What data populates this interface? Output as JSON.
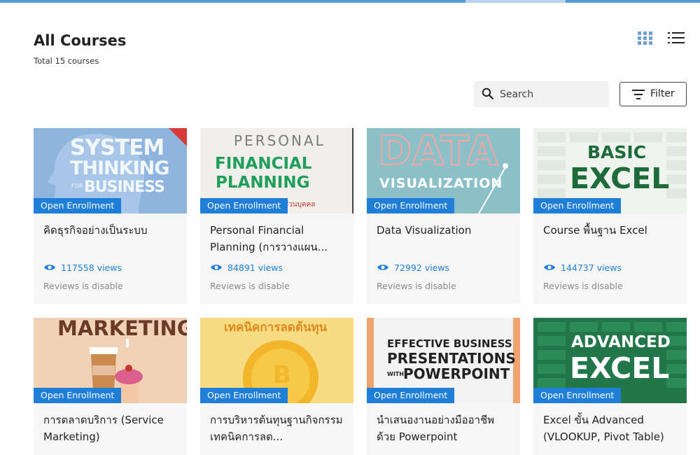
{
  "page": {
    "title": "All Courses",
    "subtitle": "Total 15 courses"
  },
  "search": {
    "placeholder": "Search"
  },
  "filter": {
    "label": "Filter"
  },
  "colors": {
    "accent": "#1f7fd8",
    "topbar": "#5b9bd5",
    "card_bg": "#f6f6f6"
  },
  "courses": [
    {
      "badge": "Open Enrollment",
      "title": "คิดธุรกิจอย่างเป็นระบบ",
      "views": "117558 views",
      "reviews": "Reviews is disable",
      "thumb": {
        "lines": [
          "SYSTEM",
          "THINKING",
          "FOR",
          "BUSINESS"
        ]
      }
    },
    {
      "badge": "Open Enrollment",
      "title": "Personal Financial Planning (การวางแผน...",
      "views": "84891 views",
      "reviews": "Reviews is disable",
      "thumb": {
        "lines": [
          "PERSONAL",
          "FINANCIAL",
          "PLANNING",
          "ส่วนบุคคล"
        ]
      }
    },
    {
      "badge": "Open Enrollment",
      "title": "Data Visualization",
      "views": "72992 views",
      "reviews": "Reviews is disable",
      "thumb": {
        "lines": [
          "DATA",
          "VISUALIZATION"
        ]
      }
    },
    {
      "badge": "Open Enrollment",
      "title": "Course พื้นฐาน Excel",
      "views": "144737 views",
      "reviews": "Reviews is disable",
      "thumb": {
        "lines": [
          "BASIC",
          "EXCEL"
        ]
      }
    },
    {
      "badge": "Open Enrollment",
      "title": "การตลาดบริการ (Service Marketing)",
      "thumb": {
        "lines": [
          "MARKETING"
        ]
      }
    },
    {
      "badge": "Open Enrollment",
      "title": "การบริหารต้นทุนฐานกิจกรรม เทคนิคการลด...",
      "thumb": {
        "lines": [
          "เทคนิคการลดต้นทุน",
          "B"
        ]
      }
    },
    {
      "badge": "Open Enrollment",
      "title": "นำเสนองานอย่างมืออาชีพ ด้วย Powerpoint",
      "thumb": {
        "lines": [
          "EFFECTIVE BUSINESS",
          "PRESENTATIONS",
          "WITH",
          "POWERPOINT"
        ]
      }
    },
    {
      "badge": "Open Enrollment",
      "title": "Excel ขั้น Advanced (VLOOKUP, Pivot Table)",
      "thumb": {
        "lines": [
          "ADVANCED",
          "EXCEL"
        ]
      }
    }
  ]
}
